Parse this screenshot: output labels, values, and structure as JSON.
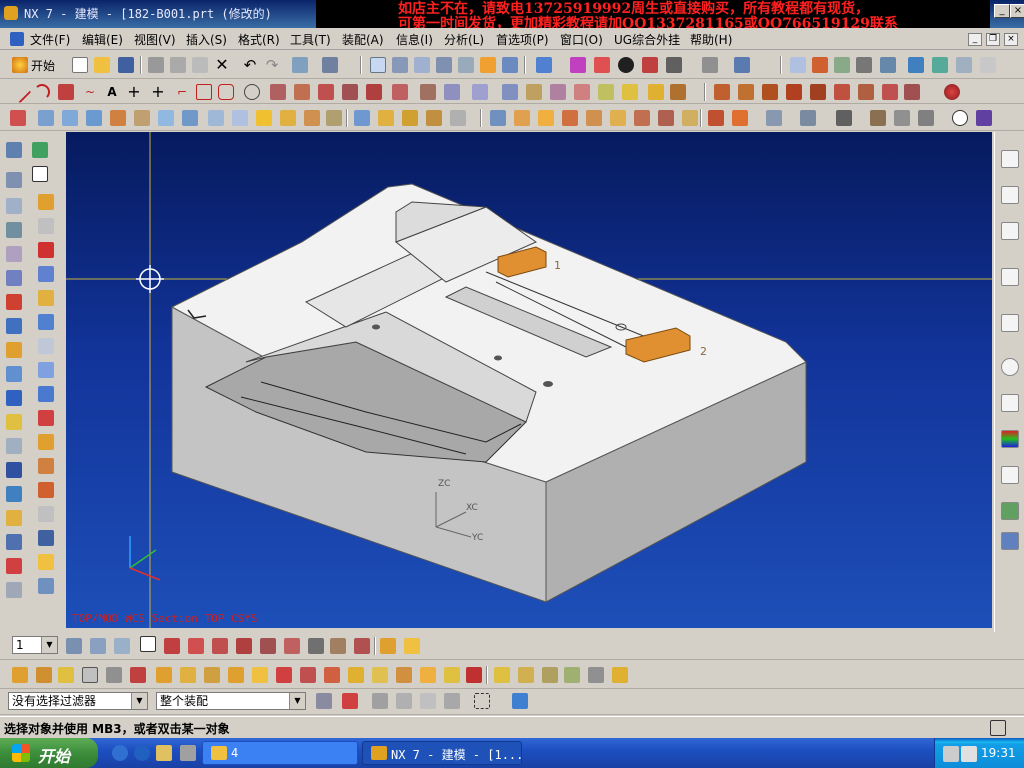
{
  "window": {
    "title": "NX 7 - 建模 - [182-B001.prt  (修改的)"
  },
  "overlay_ad": {
    "line1": "如店主不在，请致电13725919992周生或直接购买，所有教程都有现货，",
    "line2": "可第一时间发货，更加精彩教程请加QQ1337281165或QQ766519129联系"
  },
  "menubar": {
    "items": [
      "文件(F)",
      "编辑(E)",
      "视图(V)",
      "插入(S)",
      "格式(R)",
      "工具(T)",
      "装配(A)",
      "信息(I)",
      "分析(L)",
      "首选项(P)",
      "窗口(O)",
      "UG综合外挂",
      "帮助(H)"
    ]
  },
  "standard_toolbar": {
    "start_label": "开始"
  },
  "viewport": {
    "view_label": "TOP/MOD  WCS  Section  TOP  CSYS",
    "axes": {
      "zc": "ZC",
      "xc": "XC",
      "yc": "YC"
    },
    "callouts": [
      "1",
      "2"
    ]
  },
  "layer": {
    "value": "1"
  },
  "selection_bar": {
    "filter_value": "没有选择过滤器",
    "scope_value": "整个装配"
  },
  "status": {
    "prompt": "选择对象并使用 MB3，或者双击某一对象"
  },
  "taskbar": {
    "start_label": "开始",
    "tasks": [
      "4",
      "NX 7 - 建模 - [1..."
    ],
    "clock": "19:31"
  },
  "colors": {
    "title_blue": "#0a246a",
    "ad_text": "#ff2020",
    "viewport_top": "#061a5e",
    "viewport_bottom": "#1d4fb8",
    "part_face": "#f2f2f2",
    "part_side": "#c9c9c9",
    "slider_orange": "#e09030",
    "taskbar_blue": "#1d4fc1",
    "start_green": "#3c8e3c"
  }
}
